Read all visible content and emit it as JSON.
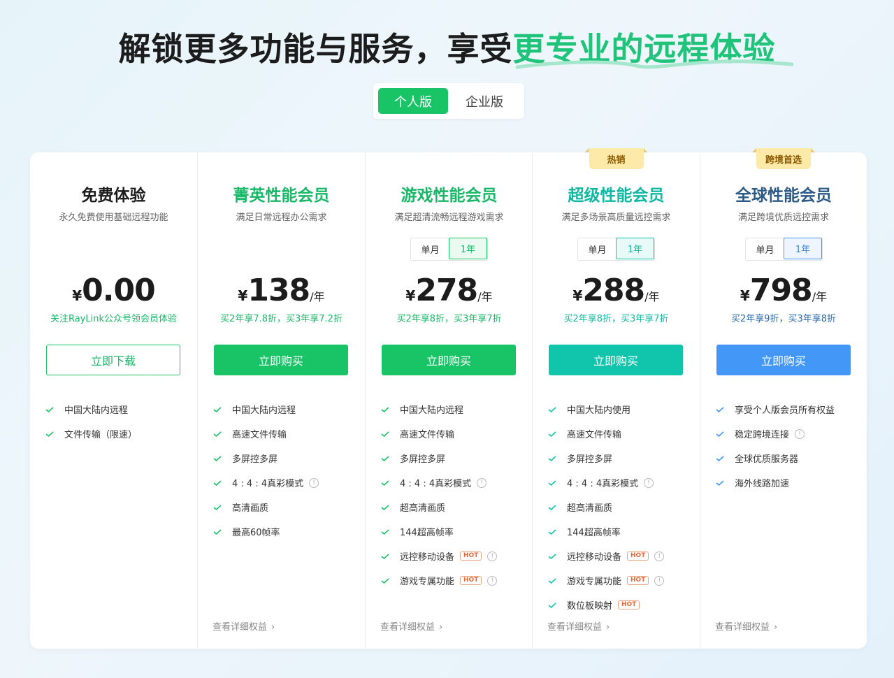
{
  "headline": {
    "plain": "解锁更多功能与服务，享受",
    "accent": "更专业的远程体验"
  },
  "tabs": [
    {
      "label": "个人版",
      "active": true
    },
    {
      "label": "企业版",
      "active": false
    }
  ],
  "billing": {
    "monthly": "单月",
    "yearly": "1年"
  },
  "details_label": "查看详细权益",
  "colors": {
    "green": "#18c466",
    "teal": "#10c5ac",
    "blue": "#4297f7",
    "navy": "#2c5a86"
  },
  "plans": [
    {
      "name": "免费体验",
      "desc": "永久免费使用基础远程功能",
      "currency": "¥",
      "price": "0.00",
      "unit": "",
      "promo": "关注RayLink公众号领会员体验",
      "cta": "立即下载",
      "features": [
        {
          "text": "中国大陆内远程"
        },
        {
          "text": "文件传输（限速）"
        }
      ]
    },
    {
      "name": "菁英性能会员",
      "desc": "满足日常远程办公需求",
      "currency": "¥",
      "price": "138",
      "unit": "/年",
      "promo": "买2年享7.8折，买3年享7.2折",
      "cta": "立即购买",
      "features": [
        {
          "text": "中国大陆内远程"
        },
        {
          "text": "高速文件传输"
        },
        {
          "text": "多屏控多屏"
        },
        {
          "text": "4 : 4 : 4真彩模式",
          "info": true
        },
        {
          "text": "高清画质"
        },
        {
          "text": "最高60帧率"
        }
      ]
    },
    {
      "name": "游戏性能会员",
      "desc": "满足超清流畅远程游戏需求",
      "currency": "¥",
      "price": "278",
      "unit": "/年",
      "promo": "买2年享8折，买3年享7折",
      "cta": "立即购买",
      "features": [
        {
          "text": "中国大陆内远程"
        },
        {
          "text": "高速文件传输"
        },
        {
          "text": "多屏控多屏"
        },
        {
          "text": "4 : 4 : 4真彩模式",
          "info": true
        },
        {
          "text": "超高清画质"
        },
        {
          "text": "144超高帧率"
        },
        {
          "text": "远控移动设备",
          "hot": "HOT",
          "info": true
        },
        {
          "text": "游戏专属功能",
          "hot": "HOT",
          "info": true
        }
      ]
    },
    {
      "name": "超级性能会员",
      "desc": "满足多场景高质量远控需求",
      "badge": "热销",
      "currency": "¥",
      "price": "288",
      "unit": "/年",
      "promo": "买2年享8折，买3年享7折",
      "cta": "立即购买",
      "features": [
        {
          "text": "中国大陆内使用"
        },
        {
          "text": "高速文件传输"
        },
        {
          "text": "多屏控多屏"
        },
        {
          "text": "4 : 4 : 4真彩模式",
          "info": true
        },
        {
          "text": "超高清画质"
        },
        {
          "text": "144超高帧率"
        },
        {
          "text": "远控移动设备",
          "hot": "HOT",
          "info": true
        },
        {
          "text": "游戏专属功能",
          "hot": "HOT",
          "info": true
        },
        {
          "text": "数位板映射",
          "hot": "HOT"
        }
      ]
    },
    {
      "name": "全球性能会员",
      "desc": "满足跨境优质远控需求",
      "badge": "跨境首选",
      "currency": "¥",
      "price": "798",
      "unit": "/年",
      "promo": "买2年享9折，买3年享8折",
      "cta": "立即购买",
      "features": [
        {
          "text": "享受个人版会员所有权益"
        },
        {
          "text": "稳定跨境连接",
          "info": true
        },
        {
          "text": "全球优质服务器"
        },
        {
          "text": "海外线路加速"
        }
      ]
    }
  ]
}
